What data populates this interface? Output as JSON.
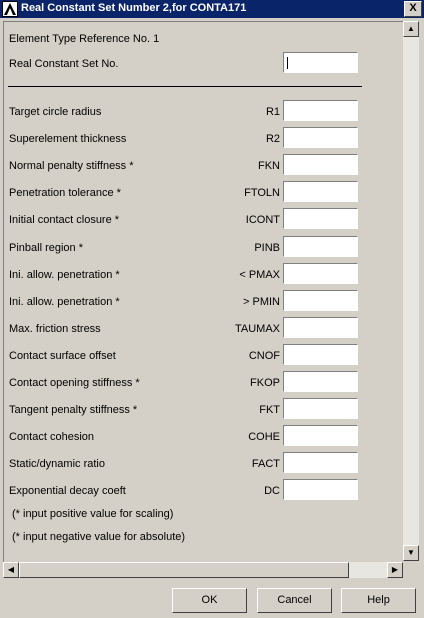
{
  "window": {
    "title": "Real Constant Set Number 2,for CONTA171",
    "close_glyph": "X",
    "icon": "ansys-logo-icon"
  },
  "header": {
    "element_type_ref": "Element Type Reference No. 1",
    "real_constant_set_label": "Real Constant Set No."
  },
  "rows": [
    {
      "label": "Target circle radius",
      "code": "R1"
    },
    {
      "label": "Superelement thickness",
      "code": "R2"
    },
    {
      "label": "Normal penalty stiffness *",
      "code": "FKN"
    },
    {
      "label": "Penetration tolerance *",
      "code": "FTOLN"
    },
    {
      "label": "Initial contact closure *",
      "code": "ICONT"
    },
    {
      "label": "Pinball region *",
      "code": "PINB"
    },
    {
      "label": "Ini. allow. penetration *",
      "code": "< PMAX"
    },
    {
      "label": "Ini. allow. penetration *",
      "code": "> PMIN"
    },
    {
      "label": "Max. friction stress",
      "code": "TAUMAX"
    },
    {
      "label": "Contact surface offset",
      "code": "CNOF"
    },
    {
      "label": "Contact opening stiffness *",
      "code": "FKOP"
    },
    {
      "label": "Tangent penalty stiffness *",
      "code": "FKT"
    },
    {
      "label": "Contact cohesion",
      "code": "COHE"
    },
    {
      "label": "Static/dynamic ratio",
      "code": "FACT"
    },
    {
      "label": "Exponential decay coeft",
      "code": "DC"
    }
  ],
  "notes": [
    "(* input positive value for scaling)",
    "(* input negative value for absolute)"
  ],
  "buttons": {
    "ok": "OK",
    "cancel": "Cancel",
    "help": "Help"
  },
  "scrollbar": {
    "up_glyph": "▲",
    "down_glyph": "▼",
    "left_glyph": "◀",
    "right_glyph": "▶"
  }
}
